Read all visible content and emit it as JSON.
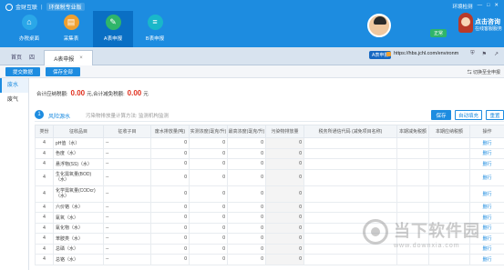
{
  "app": {
    "brand_name": "金财互联",
    "edition": "环保税专业版",
    "help_label": "环境检测",
    "status_badge": "正常",
    "service_title": "点击咨询",
    "service_sub": "在线客服服务"
  },
  "nav": {
    "items": [
      {
        "label": "办税桌面",
        "icon": "⌂",
        "color": "#2aa7e8",
        "active": false
      },
      {
        "label": "采集表",
        "icon": "▤",
        "color": "#f0a030",
        "active": false
      },
      {
        "label": "A表申报",
        "icon": "✎",
        "color": "#2fb56a",
        "active": true
      },
      {
        "label": "B表申报",
        "icon": "≡",
        "color": "#19b7c9",
        "active": false
      }
    ]
  },
  "tabs": {
    "home": "首页",
    "prev": "四",
    "active": "A表申报",
    "close": "×"
  },
  "browser": {
    "url_badge": "A表申报",
    "url": "https://hbs.jchl.com/environm",
    "icons": [
      "⛨",
      "⚑",
      "↗"
    ]
  },
  "toolbar": {
    "submit_label": "提交数据",
    "save_all_label": "保存全部",
    "switch_old_label": "⇆ 切换至全申报"
  },
  "sidebar": {
    "items": [
      {
        "label": "废水",
        "active": true
      },
      {
        "label": "废气",
        "active": false
      }
    ]
  },
  "summary": {
    "payable_label": "合计应纳税额:",
    "payable_amount": "0.00",
    "payable_unit": "元,",
    "reduction_label": "合计减免税额:",
    "reduction_amount": "0.00",
    "reduction_unit": "元"
  },
  "section": {
    "step": "1",
    "title": "风险源水",
    "subtitle": "污染物排放量计算方法:  监测机构监测",
    "save_label": "保存",
    "auto_fill_label": "自动填充",
    "reset_label": "重置"
  },
  "table": {
    "headers": [
      "类份",
      "征收品目",
      "征收子目",
      "废水排放量(吨)",
      "实测浓度(毫克/升)",
      "最高浓度(毫克/升)",
      "污染物排放量",
      "税务所通信代码 (减免项目名称)",
      "本期减免税额",
      "本期应纳税额",
      "操作"
    ],
    "rows": [
      {
        "type": "4",
        "item": "pH值（水）",
        "sub": "--",
        "v1": "0",
        "v2": "0",
        "v3": "0",
        "v4": "0",
        "action": "删行",
        "tall": false
      },
      {
        "type": "4",
        "item": "色度（水）",
        "sub": "--",
        "v1": "0",
        "v2": "0",
        "v3": "0",
        "v4": "0",
        "action": "删行",
        "tall": false
      },
      {
        "type": "4",
        "item": "悬浮物(SS)（水）",
        "sub": "--",
        "v1": "0",
        "v2": "0",
        "v3": "0",
        "v4": "0",
        "action": "删行",
        "tall": false
      },
      {
        "type": "4",
        "item": "生化需氧量(BOD)（水）",
        "sub": "--",
        "v1": "0",
        "v2": "0",
        "v3": "0",
        "v4": "0",
        "action": "删行",
        "tall": true
      },
      {
        "type": "4",
        "item": "化学需氧量(CODcr)（水）",
        "sub": "--",
        "v1": "0",
        "v2": "0",
        "v3": "0",
        "v4": "0",
        "action": "删行",
        "tall": true
      },
      {
        "type": "4",
        "item": "六价铬（水）",
        "sub": "--",
        "v1": "0",
        "v2": "0",
        "v3": "0",
        "v4": "0",
        "action": "删行",
        "tall": false
      },
      {
        "type": "4",
        "item": "氰氧（水）",
        "sub": "--",
        "v1": "0",
        "v2": "0",
        "v3": "0",
        "v4": "0",
        "action": "删行",
        "tall": false
      },
      {
        "type": "4",
        "item": "氰化物（水）",
        "sub": "--",
        "v1": "0",
        "v2": "0",
        "v3": "0",
        "v4": "0",
        "action": "删行",
        "tall": false
      },
      {
        "type": "4",
        "item": "苯胺类（水）",
        "sub": "--",
        "v1": "0",
        "v2": "0",
        "v3": "0",
        "v4": "0",
        "action": "删行",
        "tall": false
      },
      {
        "type": "4",
        "item": "总磷（水）",
        "sub": "--",
        "v1": "0",
        "v2": "0",
        "v3": "0",
        "v4": "0",
        "action": "删行",
        "tall": false
      },
      {
        "type": "4",
        "item": "总铬（水）",
        "sub": "--",
        "v1": "0",
        "v2": "0",
        "v3": "0",
        "v4": "0",
        "action": "删行",
        "tall": false
      }
    ]
  },
  "watermark": {
    "title": "当下软件园",
    "url": "www.downxia.com"
  }
}
